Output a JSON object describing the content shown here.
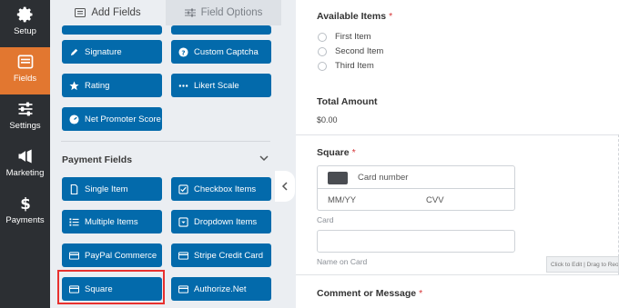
{
  "nav": {
    "items": [
      {
        "label": "Setup",
        "icon": "gear-icon",
        "active": false
      },
      {
        "label": "Fields",
        "icon": "list-icon",
        "active": true
      },
      {
        "label": "Settings",
        "icon": "sliders-icon",
        "active": false
      },
      {
        "label": "Marketing",
        "icon": "megaphone-icon",
        "active": false
      },
      {
        "label": "Payments",
        "icon": "dollar-icon",
        "active": false
      }
    ]
  },
  "tabs": {
    "add_fields": "Add Fields",
    "field_options": "Field Options"
  },
  "fields": {
    "top_buttons": [
      {
        "label": "Signature",
        "icon": "pen-icon"
      },
      {
        "label": "Custom Captcha",
        "icon": "question-icon"
      },
      {
        "label": "Rating",
        "icon": "star-icon"
      },
      {
        "label": "Likert Scale",
        "icon": "dots-icon"
      },
      {
        "label": "Net Promoter Score",
        "icon": "gauge-icon"
      }
    ],
    "payment_section_title": "Payment Fields",
    "payment_buttons": [
      {
        "label": "Single Item",
        "icon": "file-icon"
      },
      {
        "label": "Checkbox Items",
        "icon": "checkbox-icon"
      },
      {
        "label": "Multiple Items",
        "icon": "list-icon"
      },
      {
        "label": "Dropdown Items",
        "icon": "dropdown-icon"
      },
      {
        "label": "PayPal Commerce",
        "icon": "card-icon"
      },
      {
        "label": "Stripe Credit Card",
        "icon": "card-icon"
      },
      {
        "label": "Square",
        "icon": "card-icon"
      },
      {
        "label": "Authorize.Net",
        "icon": "card-icon"
      }
    ]
  },
  "preview": {
    "available_items": {
      "label": "Available Items",
      "required": "*",
      "options": [
        "First Item",
        "Second Item",
        "Third Item"
      ]
    },
    "total_amount": {
      "label": "Total Amount",
      "value": "$0.00"
    },
    "square": {
      "label": "Square",
      "required": "*",
      "card_number_placeholder": "Card number",
      "expiry_placeholder": "MM/YY",
      "cvv_placeholder": "CVV",
      "card_sublabel": "Card",
      "name_sublabel": "Name on Card"
    },
    "drag_tip": "Click to Edit | Drag to Reorder",
    "comment": {
      "label": "Comment or Message",
      "required": "*"
    }
  },
  "colors": {
    "nav_bg": "#2c2f33",
    "nav_active": "#e27730",
    "button_blue": "#036aab",
    "highlight_red": "#e8312f",
    "required_red": "#d63638"
  }
}
